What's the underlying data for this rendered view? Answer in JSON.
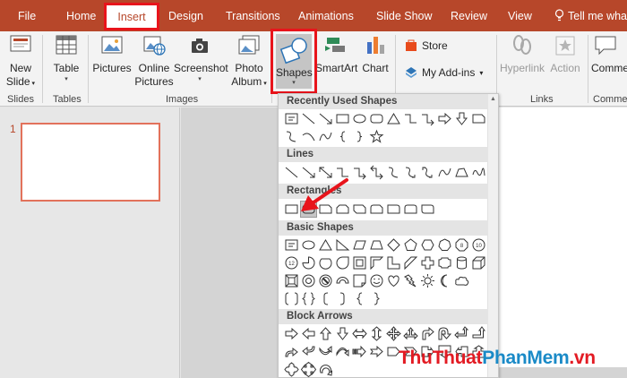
{
  "tabs": {
    "file": "File",
    "home": "Home",
    "insert": "Insert",
    "design": "Design",
    "transitions": "Transitions",
    "animations": "Animations",
    "slideshow": "Slide Show",
    "review": "Review",
    "view": "View",
    "tellme": "Tell me what"
  },
  "ribbon": {
    "new_slide": [
      "New",
      "Slide"
    ],
    "table": "Table",
    "pictures": "Pictures",
    "online_pictures": [
      "Online",
      "Pictures"
    ],
    "screenshot": "Screenshot",
    "photo_album": [
      "Photo",
      "Album"
    ],
    "shapes": "Shapes",
    "smartart": "SmartArt",
    "chart": "Chart",
    "store": "Store",
    "my_addins": "My Add-ins",
    "hyperlink": "Hyperlink",
    "action": "Action",
    "comment": "Comme",
    "groups": {
      "slides": "Slides",
      "tables": "Tables",
      "images": "Images",
      "links": "Links",
      "comments": "Comme"
    }
  },
  "slides": {
    "number": "1"
  },
  "dropdown": {
    "sections": {
      "recent": "Recently Used Shapes",
      "lines": "Lines",
      "rectangles": "Rectangles",
      "basic": "Basic Shapes",
      "block_arrows": "Block Arrows"
    }
  },
  "watermark": {
    "part1": "ThuThuat",
    "part2": "PhanMem",
    "part3": ".vn"
  },
  "colors": {
    "brand": "#b7472a",
    "highlight": "#e8141b"
  }
}
